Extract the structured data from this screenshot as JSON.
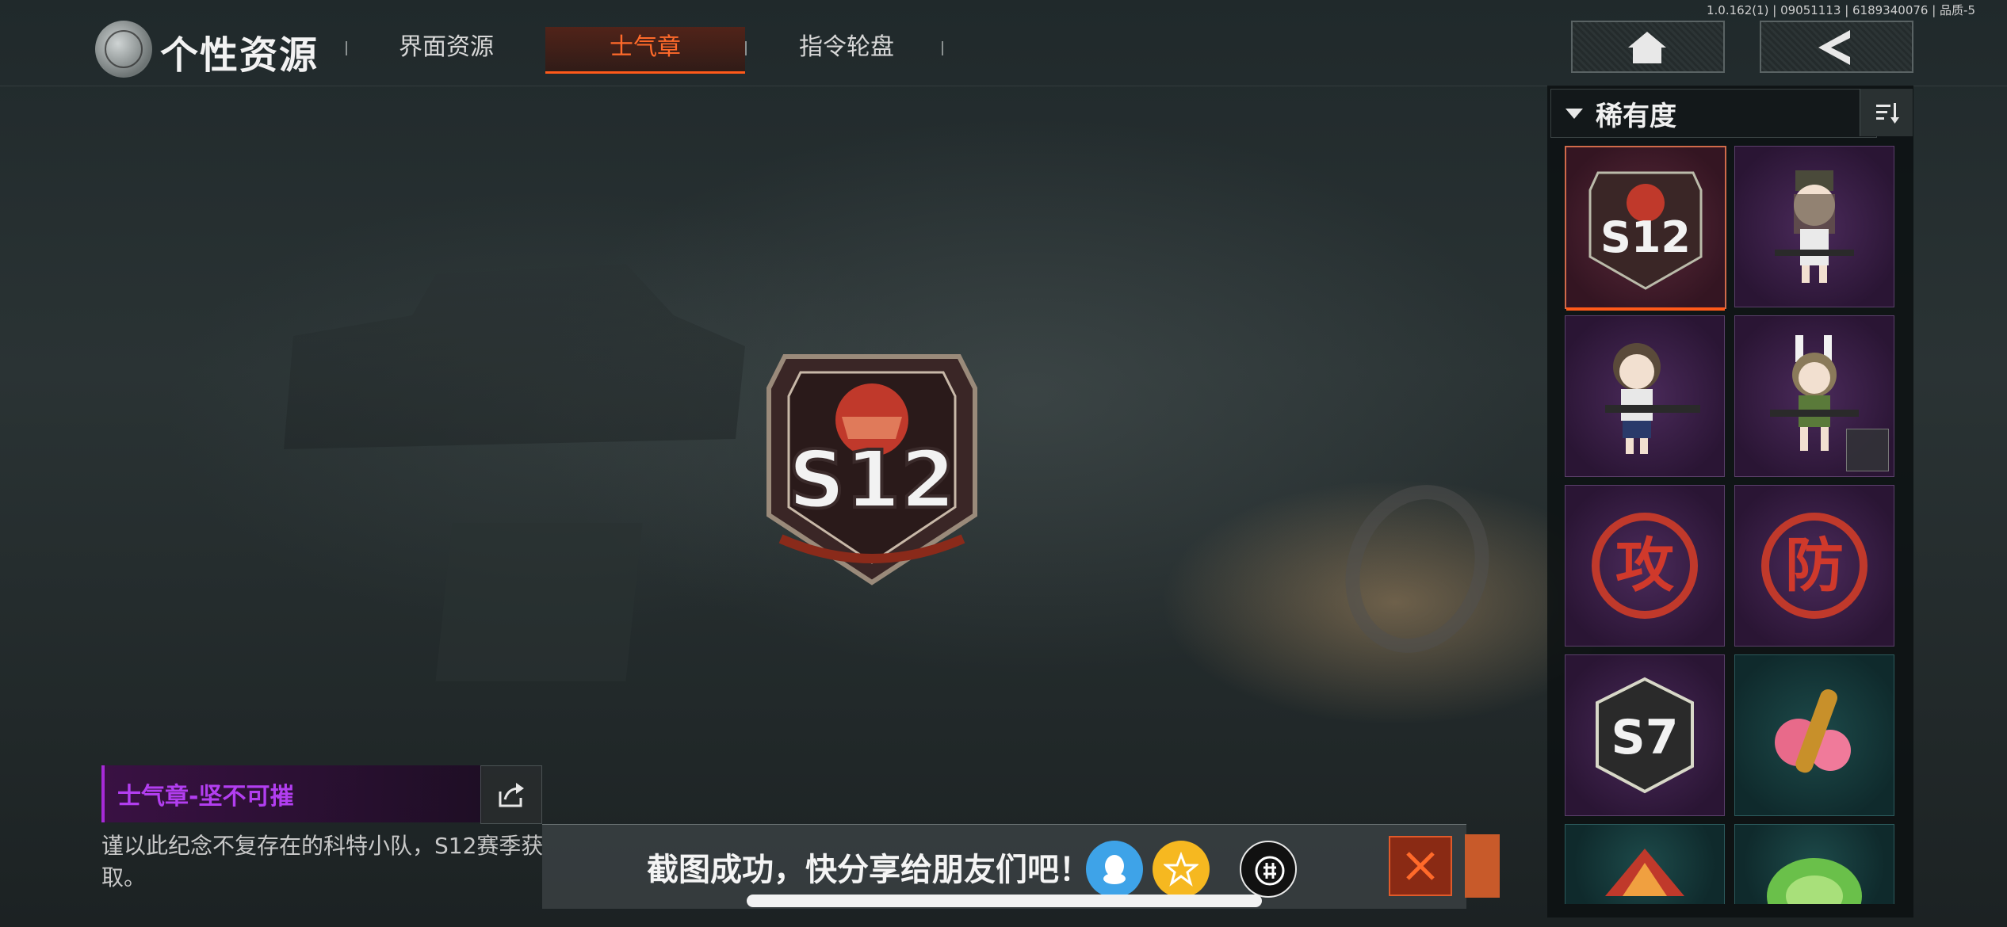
{
  "header": {
    "version": "1.0.162(1) | 09051113 | 6189340076 | 品质-5",
    "title": "个性资源",
    "tabs": [
      {
        "label": "界面资源"
      },
      {
        "label": "士气章"
      },
      {
        "label": "指令轮盘"
      }
    ],
    "active_tab": "士气章"
  },
  "nav": {
    "home_icon": "home-icon",
    "back_icon": "back-chevron-icon"
  },
  "preview": {
    "badge_text": "S12",
    "badge_name": "士气章-坚不可摧",
    "description": "谨以此纪念不复存在的科特小队，S12赛季获取。"
  },
  "filter": {
    "label": "稀有度",
    "sort_icon": "sort-icon"
  },
  "items": [
    {
      "icon": "s12-badge",
      "selected": true,
      "bg": "purple"
    },
    {
      "icon": "chibi-soldier-cap",
      "bg": "purple"
    },
    {
      "icon": "chibi-girl-rifle",
      "bg": "purple"
    },
    {
      "icon": "chibi-bunny-girl",
      "bg": "purple",
      "locked": true
    },
    {
      "icon": "attack-glyph-攻",
      "bg": "purple"
    },
    {
      "icon": "defend-glyph-防",
      "bg": "purple"
    },
    {
      "icon": "s7-badge",
      "bg": "purple"
    },
    {
      "icon": "bullet-flower",
      "bg": "teal"
    },
    {
      "icon": "red-creature",
      "bg": "teal"
    },
    {
      "icon": "green-food",
      "bg": "teal"
    }
  ],
  "toast": {
    "text": "截图成功，快分享给朋友们吧！",
    "share_targets": [
      "qq-icon",
      "qzone-icon",
      "share-other-icon"
    ],
    "close_icon": "close-icon"
  },
  "colors": {
    "accent": "#ff5a1a",
    "name_purple": "#b23ef0",
    "qq_blue": "#3ea3e8",
    "qzone_yellow": "#f6b820"
  }
}
